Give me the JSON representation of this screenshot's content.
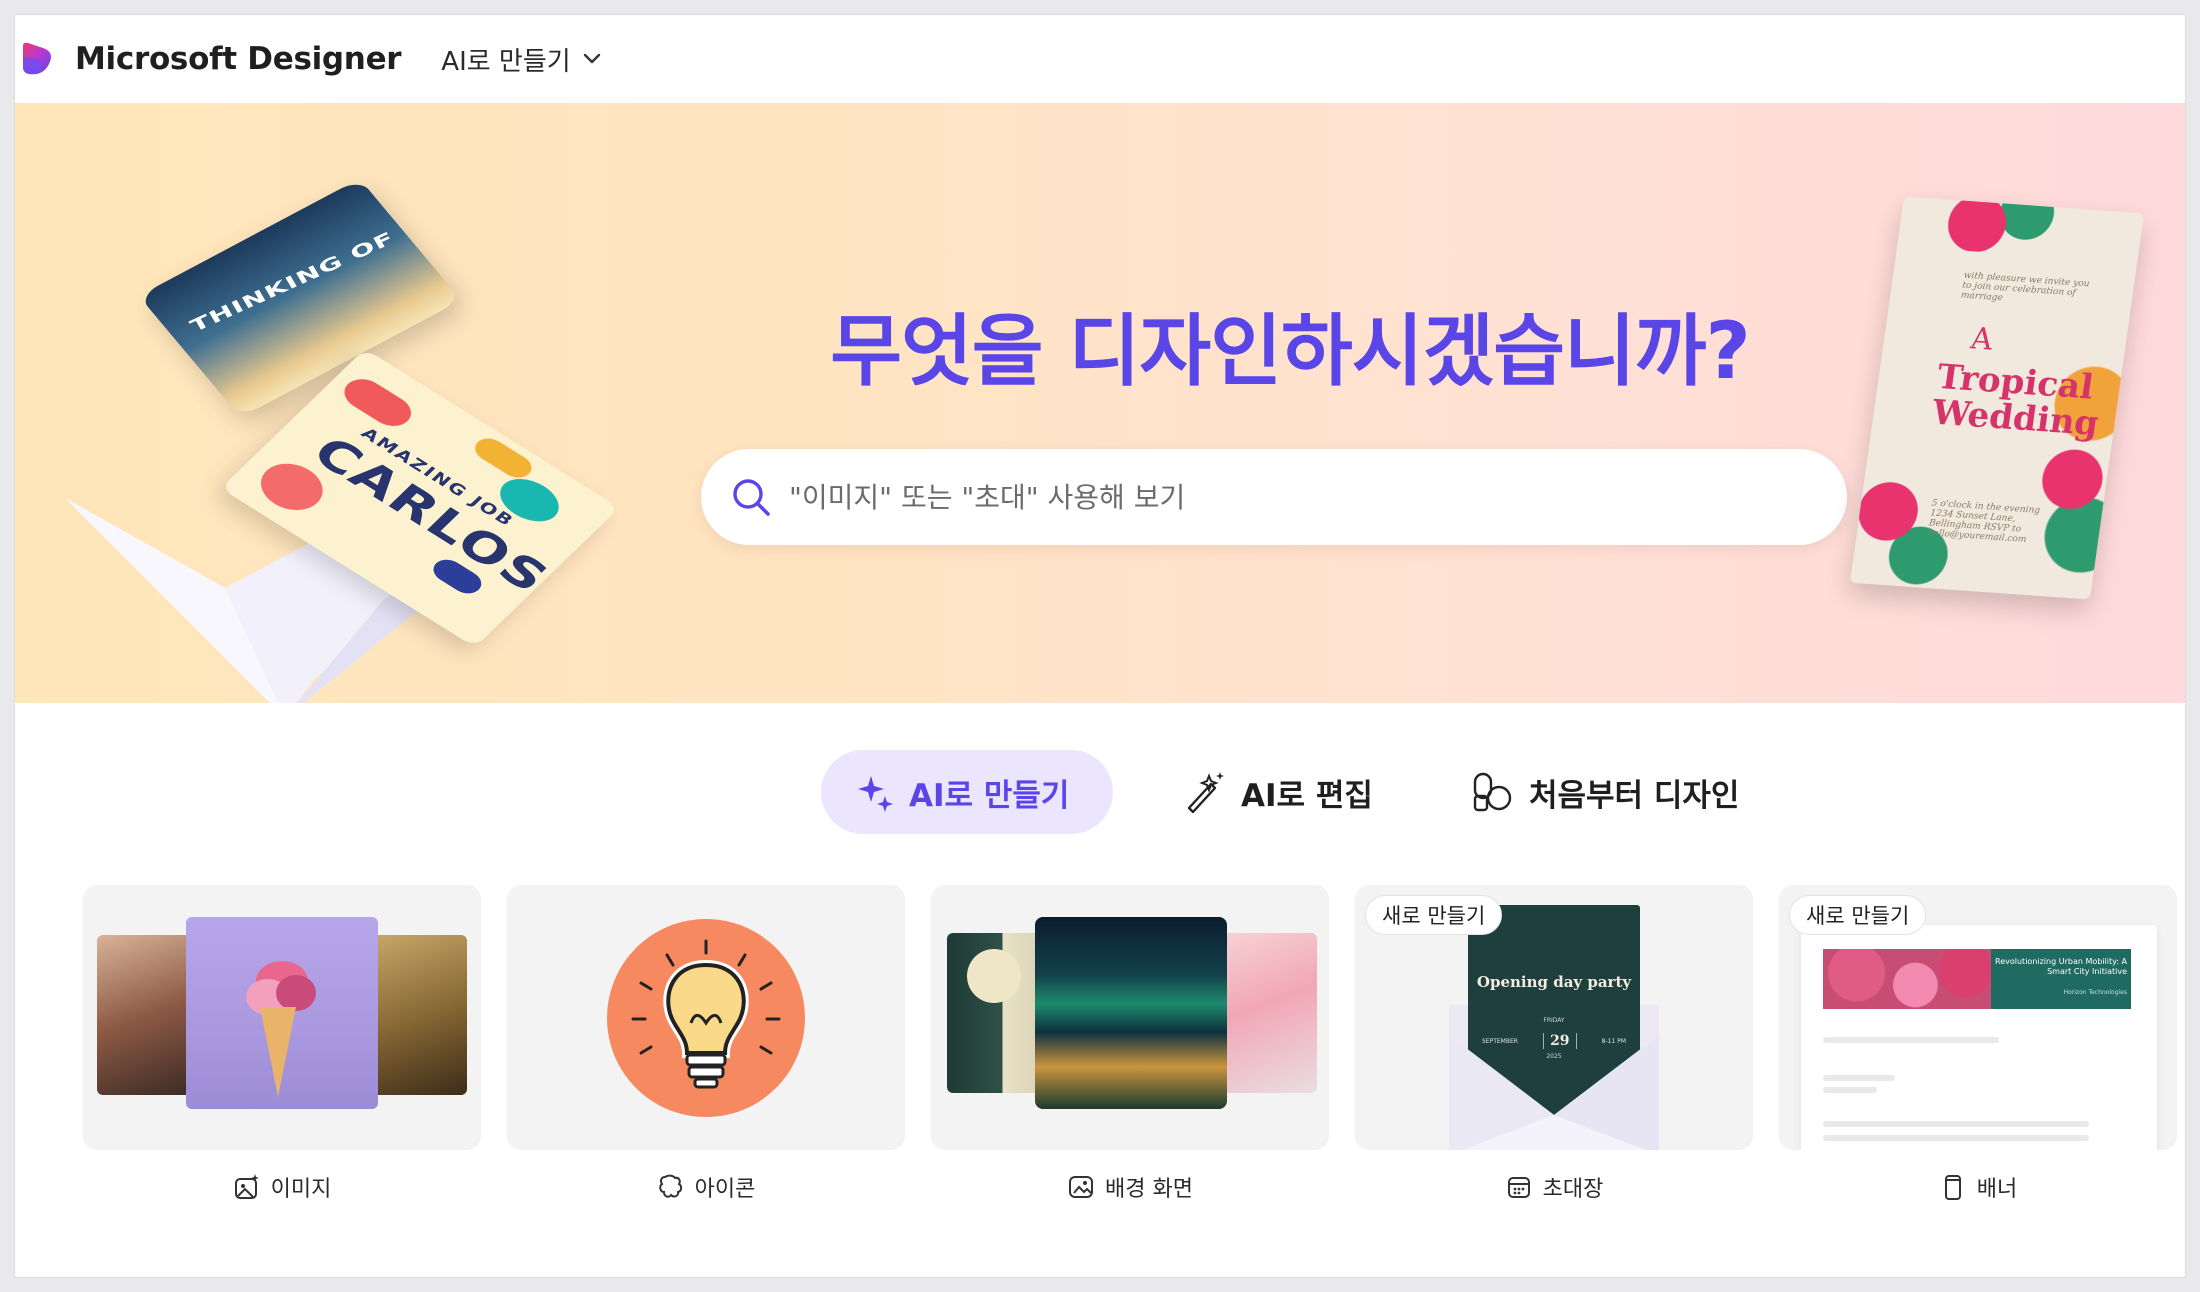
{
  "app": {
    "brand_name": "Microsoft Designer",
    "mode_dropdown": "AI로 만들기",
    "accent_color": "#5b44e8"
  },
  "hero": {
    "title": "무엇을 디자인하시겠습니까?",
    "search_placeholder": "\"이미지\" 또는 \"초대\" 사용해 보기",
    "cards": {
      "sky_card_text": "THINKING OF YOU",
      "carlos_top": "AMAZING JOB",
      "carlos_name": "CARLOS",
      "wedding_line1": "A",
      "wedding_line2": "Tropical Wedding",
      "wedding_top_small": "with pleasure we invite you to join our celebration of marriage",
      "wedding_bottom_small": "5 o'clock in the evening 1234 Sunset Lane, Bellingham RSVP to hello@youremail.com"
    }
  },
  "tabs": [
    {
      "label": "AI로 만들기",
      "icon": "sparkle-icon",
      "active": true
    },
    {
      "label": "AI로 편집",
      "icon": "magic-wand-icon",
      "active": false
    },
    {
      "label": "처음부터 디자인",
      "icon": "shapes-icon",
      "active": false
    }
  ],
  "categories": [
    {
      "label": "이미지",
      "icon": "image-sparkle-icon",
      "badge": ""
    },
    {
      "label": "아이콘",
      "icon": "icon-shape-icon",
      "badge": ""
    },
    {
      "label": "배경 화면",
      "icon": "wallpaper-icon",
      "badge": ""
    },
    {
      "label": "초대장",
      "icon": "calendar-icon",
      "badge": "새로 만들기",
      "preview": {
        "title": "Opening day party",
        "weekday": "FRIDAY",
        "month": "SEPTEMBER",
        "day": "29",
        "time": "8-11 PM",
        "year": "2025"
      }
    },
    {
      "label": "배너",
      "icon": "phone-banner-icon",
      "badge": "새로 만들기",
      "preview": {
        "heading": "Revolutionizing Urban Mobility: A Smart City Initiative",
        "sub": "Horizon Technologies"
      }
    }
  ]
}
